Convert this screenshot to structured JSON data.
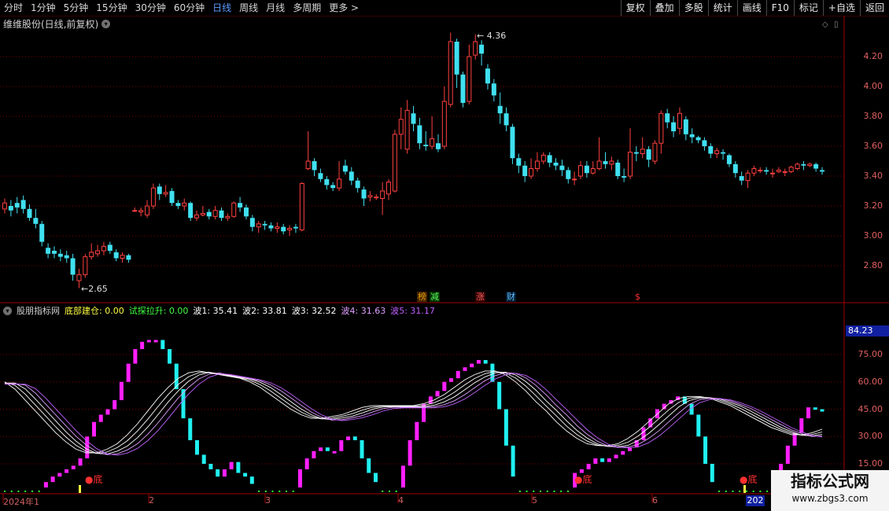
{
  "toolbar": {
    "tabs": [
      "分时",
      "1分钟",
      "5分钟",
      "15分钟",
      "30分钟",
      "60分钟",
      "日线",
      "周线",
      "月线",
      "多周期",
      "更多"
    ],
    "active_tab": "日线",
    "more_arrow": ">",
    "right_buttons": [
      "复权",
      "叠加",
      "多股",
      "统计",
      "画线",
      "F10",
      "标记",
      "+自选",
      "返回"
    ]
  },
  "price_panel": {
    "title": "维维股份(日线,前复权)",
    "y_ticks": [
      "4.20",
      "4.00",
      "3.80",
      "3.60",
      "3.40",
      "3.20",
      "3.00",
      "2.80"
    ],
    "high_label": "4.36",
    "low_label": "2.65",
    "markers": [
      {
        "text": "榜",
        "color": "#e0a000",
        "bg": "#402000"
      },
      {
        "text": "减",
        "color": "#60ff60",
        "bg": "#003000"
      },
      {
        "text": "涨",
        "color": "#ff6060",
        "bg": "#300000"
      },
      {
        "text": "财",
        "color": "#60c0ff",
        "bg": "#001a30"
      },
      {
        "text": "$",
        "color": "#ff3030",
        "bg": "transparent"
      }
    ]
  },
  "indicator_panel": {
    "name": "股朋指标网",
    "items": [
      {
        "label": "底部建仓: 0.00",
        "color": "#ffff40"
      },
      {
        "label": "试探拉升: 0.00",
        "color": "#40ff40"
      },
      {
        "label": "波1: 35.41",
        "color": "#ffffff"
      },
      {
        "label": "波2: 33.81",
        "color": "#ffffff"
      },
      {
        "label": "波3: 32.52",
        "color": "#ffffff"
      },
      {
        "label": "波4: 31.63",
        "color": "#e0a0ff"
      },
      {
        "label": "波5: 31.17",
        "color": "#c060ff"
      }
    ],
    "y_ticks": [
      "75.00",
      "60.00",
      "45.00",
      "30.00",
      "15.00"
    ],
    "current_value": "84.23",
    "bottom_label": "底"
  },
  "x_axis": {
    "labels": [
      "2024年1",
      "2",
      "3",
      "4",
      "5",
      "6"
    ],
    "cursor_label": "202"
  },
  "watermark": {
    "line1": "指标公式网",
    "line2": "www.zbgs3.com"
  },
  "chart_data": {
    "type": "candlestick",
    "price_series": {
      "name": "维维股份",
      "ylim": [
        2.6,
        4.45
      ],
      "ohlc": [
        [
          3.18,
          3.22,
          3.25,
          3.15
        ],
        [
          3.2,
          3.17,
          3.24,
          3.13
        ],
        [
          3.22,
          3.19,
          3.26,
          3.15
        ],
        [
          3.24,
          3.18,
          3.27,
          3.15
        ],
        [
          3.18,
          3.12,
          3.21,
          3.1
        ],
        [
          3.12,
          3.08,
          3.18,
          3.05
        ],
        [
          3.08,
          2.96,
          3.1,
          2.93
        ],
        [
          2.92,
          2.88,
          2.95,
          2.85
        ],
        [
          2.9,
          2.88,
          2.93,
          2.85
        ],
        [
          2.88,
          2.86,
          2.91,
          2.83
        ],
        [
          2.87,
          2.85,
          2.9,
          2.82
        ],
        [
          2.85,
          2.74,
          2.88,
          2.7
        ],
        [
          2.7,
          2.74,
          2.78,
          2.65
        ],
        [
          2.74,
          2.86,
          2.88,
          2.72
        ],
        [
          2.86,
          2.89,
          2.95,
          2.84
        ],
        [
          2.88,
          2.9,
          2.94,
          2.86
        ],
        [
          2.9,
          2.93,
          2.96,
          2.87
        ],
        [
          2.94,
          2.9,
          2.96,
          2.88
        ],
        [
          2.89,
          2.85,
          2.91,
          2.83
        ],
        [
          2.85,
          2.87,
          2.89,
          2.82
        ],
        [
          2.87,
          2.84,
          2.88,
          2.82
        ],
        [
          3.17,
          3.17,
          3.19,
          3.16
        ],
        [
          3.16,
          3.17,
          3.19,
          3.13
        ],
        [
          3.14,
          3.2,
          3.24,
          3.12
        ],
        [
          3.2,
          3.32,
          3.35,
          3.18
        ],
        [
          3.33,
          3.28,
          3.35,
          3.24
        ],
        [
          3.28,
          3.29,
          3.34,
          3.26
        ],
        [
          3.3,
          3.22,
          3.32,
          3.2
        ],
        [
          3.22,
          3.2,
          3.24,
          3.18
        ],
        [
          3.2,
          3.22,
          3.25,
          3.17
        ],
        [
          3.22,
          3.12,
          3.23,
          3.1
        ],
        [
          3.12,
          3.14,
          3.17,
          3.1
        ],
        [
          3.14,
          3.15,
          3.2,
          3.13
        ],
        [
          3.16,
          3.13,
          3.18,
          3.11
        ],
        [
          3.13,
          3.17,
          3.2,
          3.11
        ],
        [
          3.17,
          3.12,
          3.19,
          3.1
        ],
        [
          3.12,
          3.13,
          3.15,
          3.1
        ],
        [
          3.13,
          3.22,
          3.23,
          3.12
        ],
        [
          3.22,
          3.19,
          3.26,
          3.16
        ],
        [
          3.19,
          3.13,
          3.21,
          3.11
        ],
        [
          3.12,
          3.06,
          3.14,
          3.03
        ],
        [
          3.06,
          3.08,
          3.1,
          3.02
        ],
        [
          3.08,
          3.07,
          3.1,
          3.04
        ],
        [
          3.07,
          3.05,
          3.09,
          3.03
        ],
        [
          3.05,
          3.06,
          3.09,
          3.02
        ],
        [
          3.06,
          3.03,
          3.08,
          3.01
        ],
        [
          3.04,
          3.05,
          3.07,
          3.0
        ],
        [
          3.06,
          3.05,
          3.08,
          3.02
        ],
        [
          3.04,
          3.35,
          3.36,
          3.03
        ],
        [
          3.45,
          3.5,
          3.7,
          3.44
        ],
        [
          3.5,
          3.44,
          3.52,
          3.4
        ],
        [
          3.42,
          3.38,
          3.45,
          3.36
        ],
        [
          3.38,
          3.34,
          3.4,
          3.31
        ],
        [
          3.34,
          3.32,
          3.36,
          3.3
        ],
        [
          3.32,
          3.38,
          3.5,
          3.3
        ],
        [
          3.47,
          3.43,
          3.51,
          3.41
        ],
        [
          3.43,
          3.37,
          3.46,
          3.34
        ],
        [
          3.37,
          3.32,
          3.39,
          3.29
        ],
        [
          3.31,
          3.25,
          3.33,
          3.2
        ],
        [
          3.26,
          3.27,
          3.3,
          3.23
        ],
        [
          3.26,
          3.26,
          3.28,
          3.24
        ],
        [
          3.25,
          3.3,
          3.36,
          3.14
        ],
        [
          3.28,
          3.36,
          3.38,
          3.24
        ],
        [
          3.3,
          3.68,
          3.71,
          3.29
        ],
        [
          3.68,
          3.78,
          3.86,
          3.58
        ],
        [
          3.58,
          3.84,
          3.91,
          3.55
        ],
        [
          3.82,
          3.75,
          3.87,
          3.7
        ],
        [
          3.74,
          3.62,
          3.79,
          3.58
        ],
        [
          3.61,
          3.6,
          3.7,
          3.57
        ],
        [
          3.6,
          3.65,
          3.8,
          3.58
        ],
        [
          3.62,
          3.58,
          3.68,
          3.56
        ],
        [
          3.6,
          3.9,
          4.0,
          3.58
        ],
        [
          3.88,
          4.3,
          4.36,
          3.86
        ],
        [
          4.3,
          4.08,
          4.32,
          3.99
        ],
        [
          4.08,
          3.89,
          4.1,
          3.86
        ],
        [
          3.9,
          4.2,
          4.28,
          3.88
        ],
        [
          4.21,
          4.3,
          4.35,
          4.18
        ],
        [
          4.28,
          4.22,
          4.31,
          4.14
        ],
        [
          4.12,
          4.02,
          4.15,
          3.98
        ],
        [
          4.02,
          3.94,
          4.05,
          3.9
        ],
        [
          3.87,
          3.82,
          3.96,
          3.75
        ],
        [
          3.82,
          3.74,
          3.86,
          3.7
        ],
        [
          3.73,
          3.52,
          3.75,
          3.48
        ],
        [
          3.52,
          3.47,
          3.55,
          3.42
        ],
        [
          3.47,
          3.4,
          3.5,
          3.36
        ],
        [
          3.4,
          3.45,
          3.52,
          3.38
        ],
        [
          3.45,
          3.5,
          3.56,
          3.43
        ],
        [
          3.5,
          3.54,
          3.56,
          3.48
        ],
        [
          3.54,
          3.49,
          3.56,
          3.46
        ],
        [
          3.49,
          3.47,
          3.52,
          3.44
        ],
        [
          3.47,
          3.44,
          3.51,
          3.4
        ],
        [
          3.44,
          3.38,
          3.46,
          3.35
        ],
        [
          3.38,
          3.38,
          3.43,
          3.34
        ],
        [
          3.4,
          3.47,
          3.5,
          3.38
        ],
        [
          3.47,
          3.42,
          3.5,
          3.39
        ],
        [
          3.42,
          3.45,
          3.5,
          3.41
        ],
        [
          3.45,
          3.5,
          3.66,
          3.44
        ],
        [
          3.5,
          3.48,
          3.56,
          3.45
        ],
        [
          3.48,
          3.5,
          3.53,
          3.44
        ],
        [
          3.49,
          3.4,
          3.51,
          3.38
        ],
        [
          3.4,
          3.39,
          3.45,
          3.36
        ],
        [
          3.4,
          3.56,
          3.72,
          3.38
        ],
        [
          3.56,
          3.55,
          3.6,
          3.5
        ],
        [
          3.55,
          3.58,
          3.66,
          3.52
        ],
        [
          3.58,
          3.51,
          3.6,
          3.46
        ],
        [
          3.5,
          3.62,
          3.64,
          3.48
        ],
        [
          3.62,
          3.82,
          3.84,
          3.55
        ],
        [
          3.82,
          3.76,
          3.85,
          3.72
        ],
        [
          3.76,
          3.7,
          3.8,
          3.66
        ],
        [
          3.72,
          3.82,
          3.86,
          3.68
        ],
        [
          3.78,
          3.68,
          3.8,
          3.64
        ],
        [
          3.68,
          3.66,
          3.72,
          3.62
        ],
        [
          3.66,
          3.64,
          3.67,
          3.62
        ],
        [
          3.64,
          3.6,
          3.66,
          3.57
        ],
        [
          3.6,
          3.55,
          3.62,
          3.52
        ],
        [
          3.55,
          3.57,
          3.59,
          3.52
        ],
        [
          3.56,
          3.55,
          3.58,
          3.51
        ],
        [
          3.54,
          3.48,
          3.55,
          3.46
        ],
        [
          3.48,
          3.42,
          3.5,
          3.39
        ],
        [
          3.4,
          3.37,
          3.43,
          3.34
        ],
        [
          3.37,
          3.42,
          3.44,
          3.32
        ],
        [
          3.42,
          3.45,
          3.47,
          3.4
        ],
        [
          3.44,
          3.44,
          3.46,
          3.42
        ],
        [
          3.44,
          3.43,
          3.46,
          3.41
        ],
        [
          3.42,
          3.42,
          3.45,
          3.39
        ],
        [
          3.43,
          3.44,
          3.46,
          3.42
        ],
        [
          3.43,
          3.43,
          3.45,
          3.4
        ],
        [
          3.43,
          3.46,
          3.47,
          3.42
        ],
        [
          3.45,
          3.48,
          3.49,
          3.44
        ],
        [
          3.48,
          3.47,
          3.5,
          3.44
        ],
        [
          3.47,
          3.48,
          3.49,
          3.46
        ],
        [
          3.48,
          3.45,
          3.49,
          3.43
        ],
        [
          3.44,
          3.43,
          3.46,
          3.41
        ]
      ]
    },
    "indicator": {
      "ylim": [
        0,
        90
      ],
      "bars": [
        2,
        2,
        2,
        2,
        2,
        2,
        5,
        8,
        10,
        12,
        14,
        18,
        30,
        38,
        42,
        45,
        50,
        60,
        70,
        78,
        82,
        83,
        83,
        78,
        70,
        56,
        40,
        28,
        20,
        15,
        12,
        8,
        12,
        16,
        10,
        8,
        4,
        2,
        2,
        2,
        2,
        2,
        2,
        12,
        18,
        22,
        24,
        22,
        22,
        28,
        30,
        28,
        18,
        10,
        5,
        2,
        2,
        2,
        14,
        28,
        38,
        48,
        52,
        55,
        60,
        62,
        66,
        68,
        70,
        72,
        70,
        60,
        45,
        25,
        8,
        2,
        2,
        2,
        2,
        2,
        2,
        2,
        2,
        10,
        12,
        15,
        18,
        16,
        18,
        20,
        22,
        24,
        28,
        35,
        40,
        45,
        48,
        50,
        52,
        48,
        42,
        30,
        15,
        5,
        2,
        2,
        2,
        2,
        2,
        2,
        2,
        2,
        2,
        15,
        25,
        32,
        40,
        46,
        45,
        44
      ],
      "wave_lines": [
        [
          60,
          56,
          50,
          44,
          38,
          32,
          27,
          23,
          21,
          21,
          23,
          26,
          31,
          37,
          44,
          51,
          57,
          62,
          65,
          66,
          65,
          64,
          63,
          62,
          60,
          57,
          53,
          49,
          45,
          42,
          40,
          40,
          41,
          42,
          44,
          46,
          47,
          47,
          47,
          47,
          47,
          48,
          50,
          53,
          57,
          61,
          64,
          66,
          66,
          64,
          60,
          55,
          49,
          44,
          38,
          33,
          29,
          26,
          25,
          25,
          26,
          29,
          33,
          38,
          43,
          48,
          51,
          52,
          52,
          51,
          49,
          47,
          44,
          41,
          38,
          35,
          33,
          31,
          31,
          32,
          34
        ]
      ]
    },
    "x_labels": [
      "2024年1",
      "2",
      "3",
      "4",
      "5",
      "6"
    ]
  }
}
